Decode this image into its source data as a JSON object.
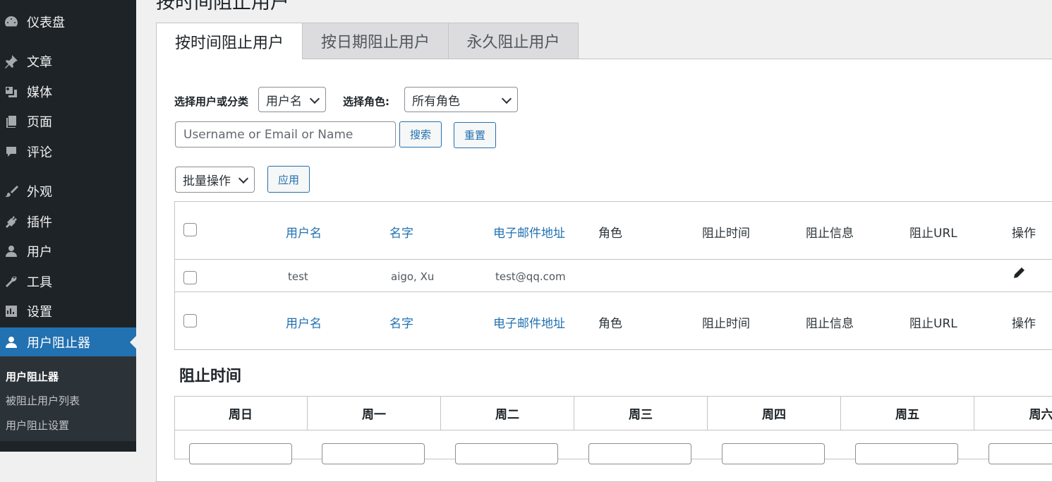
{
  "sidebar": {
    "items": [
      {
        "label": "仪表盘",
        "icon": "dashboard-icon"
      },
      {
        "label": "文章",
        "icon": "pin-icon"
      },
      {
        "label": "媒体",
        "icon": "media-icon"
      },
      {
        "label": "页面",
        "icon": "page-icon"
      },
      {
        "label": "评论",
        "icon": "comment-icon"
      },
      {
        "label": "外观",
        "icon": "brush-icon"
      },
      {
        "label": "插件",
        "icon": "plugin-icon"
      },
      {
        "label": "用户",
        "icon": "user-icon"
      },
      {
        "label": "工具",
        "icon": "wrench-icon"
      },
      {
        "label": "设置",
        "icon": "settings-icon"
      },
      {
        "label": "用户阻止器",
        "icon": "user-icon"
      }
    ],
    "submenu": [
      "用户阻止器",
      "被阻止用户列表",
      "用户阻止设置"
    ]
  },
  "page": {
    "title": "按时间阻止用户"
  },
  "tabs": [
    "按时间阻止用户",
    "按日期阻止用户",
    "永久阻止用户"
  ],
  "filters": {
    "user_or_category_label": "选择用户或分类",
    "user_select_value": "用户名",
    "role_label": "选择角色:",
    "role_select_value": "所有角色",
    "search_placeholder": "Username or Email or Name",
    "search_button": "搜索",
    "reset_button": "重置",
    "bulk_select_value": "批量操作",
    "apply_button": "应用"
  },
  "table": {
    "columns": [
      "用户名",
      "名字",
      "电子邮件地址",
      "角色",
      "阻止时间",
      "阻止信息",
      "阻止URL",
      "操作"
    ],
    "rows": [
      {
        "username": "test",
        "name": "aigo, Xu",
        "email": "test@qq.com",
        "role": "",
        "block_time": "",
        "block_msg": "",
        "block_url": ""
      }
    ]
  },
  "block_time": {
    "title": "阻止时间",
    "days": [
      "周日",
      "周一",
      "周二",
      "周三",
      "周四",
      "周五",
      "周六"
    ]
  },
  "colors": {
    "sidebar_bg": "#1d2327",
    "accent": "#2271b1",
    "submenu_bg": "#2c3338"
  }
}
